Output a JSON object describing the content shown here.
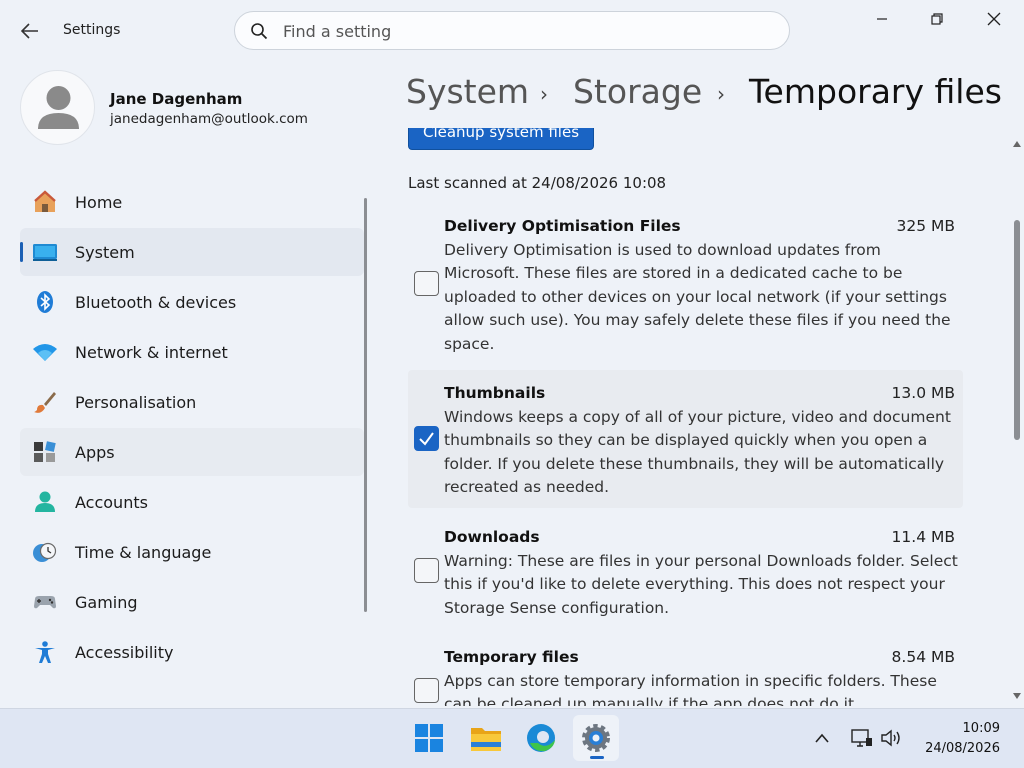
{
  "window": {
    "title": "Settings"
  },
  "search": {
    "placeholder": "Find a setting"
  },
  "user": {
    "name": "Jane Dagenham",
    "email": "janedagenham@outlook.com"
  },
  "nav": {
    "items": [
      {
        "label": "Home",
        "icon": "home-icon"
      },
      {
        "label": "System",
        "icon": "system-icon"
      },
      {
        "label": "Bluetooth & devices",
        "icon": "bluetooth-icon"
      },
      {
        "label": "Network & internet",
        "icon": "wifi-icon"
      },
      {
        "label": "Personalisation",
        "icon": "brush-icon"
      },
      {
        "label": "Apps",
        "icon": "apps-icon"
      },
      {
        "label": "Accounts",
        "icon": "accounts-icon"
      },
      {
        "label": "Time & language",
        "icon": "clock-globe-icon"
      },
      {
        "label": "Gaming",
        "icon": "gamepad-icon"
      },
      {
        "label": "Accessibility",
        "icon": "accessibility-icon"
      }
    ]
  },
  "breadcrumb": {
    "items": [
      "System",
      "Storage",
      "Temporary files"
    ]
  },
  "content": {
    "cleanup_button": "Cleanup system files",
    "last_scanned": "Last scanned at 24/08/2026 10:08",
    "files": [
      {
        "title": "Delivery Optimisation Files",
        "size": "325 MB",
        "checked": false,
        "lines": [
          "Delivery Optimisation is used to download updates from",
          "Microsoft. These files are stored in a dedicated cache to be",
          "uploaded to other devices on your local network (if your settings",
          "allow such use). You may safely delete these files if you need the",
          "space."
        ]
      },
      {
        "title": "Thumbnails",
        "size": "13.0 MB",
        "checked": true,
        "lines": [
          "Windows keeps a copy of all of your picture, video and document",
          "thumbnails so they can be displayed quickly when you open a",
          "folder. If you delete these thumbnails, they will be automatically",
          "recreated as needed."
        ]
      },
      {
        "title": "Downloads",
        "size": "11.4 MB",
        "checked": false,
        "lines": [
          "Warning: These are files in your personal Downloads folder. Select",
          "this if you'd like to delete everything. This does not respect your",
          "Storage Sense configuration."
        ]
      },
      {
        "title": "Temporary files",
        "size": "8.54 MB",
        "checked": false,
        "lines": [
          "Apps can store temporary information in specific folders. These",
          "can be cleaned up manually if the app does not do it"
        ]
      }
    ]
  },
  "taskbar": {
    "apps": [
      "windows-start-icon",
      "file-explorer-icon",
      "edge-browser-icon",
      "settings-gear-icon"
    ],
    "clock": {
      "time": "10:09",
      "date": "24/08/2026"
    }
  },
  "colors": {
    "accent": "#1a64c4",
    "background": "#eef2f8",
    "taskbar": "#dfe6f3"
  }
}
